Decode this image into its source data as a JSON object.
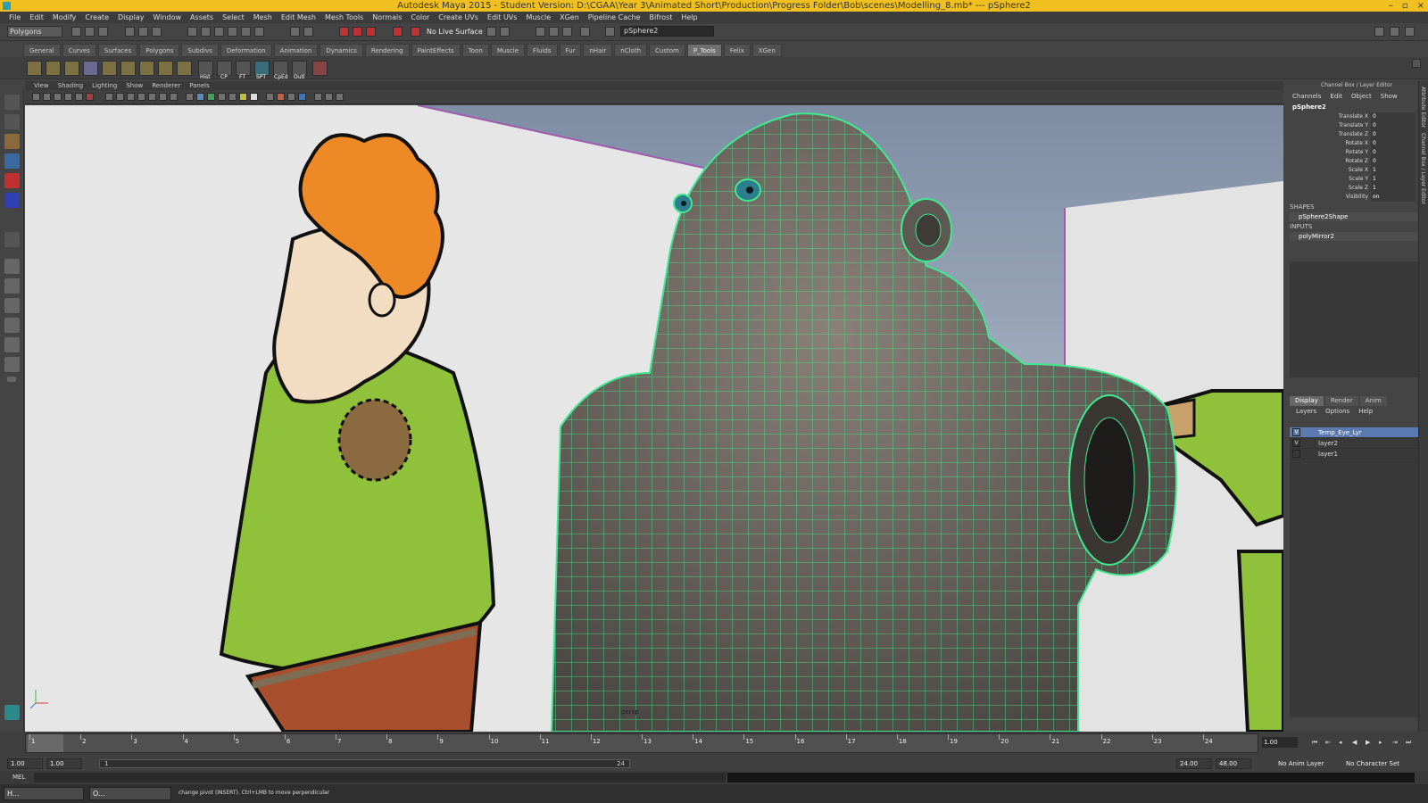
{
  "window": {
    "title": "Autodesk Maya 2015 - Student Version: D:\\CGAA\\Year 3\\Animated Short\\Production\\Progress Folder\\Bob\\scenes\\Modelling_8.mb*  ---  pSphere2",
    "minimize": "–",
    "maximize": "▫",
    "close": "×"
  },
  "menubar": [
    "File",
    "Edit",
    "Modify",
    "Create",
    "Display",
    "Window",
    "Assets",
    "Select",
    "Mesh",
    "Edit Mesh",
    "Mesh Tools",
    "Normals",
    "Color",
    "Create UVs",
    "Edit UVs",
    "Muscle",
    "XGen",
    "Pipeline Cache",
    "Bifrost",
    "Help"
  ],
  "statusline": {
    "mode": "Polygons",
    "live_surface": "No Live Surface",
    "object_field": "pSphere2"
  },
  "shelf": {
    "tabs": [
      "General",
      "Curves",
      "Surfaces",
      "Polygons",
      "Subdivs",
      "Deformation",
      "Animation",
      "Dynamics",
      "Rendering",
      "PaintEffects",
      "Toon",
      "Muscle",
      "Fluids",
      "Fur",
      "nHair",
      "nCloth",
      "Custom",
      "P_Tools",
      "Felix",
      "XGen"
    ],
    "active_tab": "P_Tools",
    "labels": [
      "Hist",
      "CP",
      "FT",
      "SPT",
      "CpEd",
      "Outl"
    ]
  },
  "viewport": {
    "menus": [
      "View",
      "Shading",
      "Lighting",
      "Show",
      "Renderer",
      "Panels"
    ],
    "camera_label": "persp"
  },
  "channel_box": {
    "header": "Channel Box / Layer Editor",
    "menus": [
      "Channels",
      "Edit",
      "Object",
      "Show"
    ],
    "object": "pSphere2",
    "attributes": [
      {
        "name": "Translate X",
        "value": "0"
      },
      {
        "name": "Translate Y",
        "value": "0"
      },
      {
        "name": "Translate Z",
        "value": "0"
      },
      {
        "name": "Rotate X",
        "value": "0"
      },
      {
        "name": "Rotate Y",
        "value": "0"
      },
      {
        "name": "Rotate Z",
        "value": "0"
      },
      {
        "name": "Scale X",
        "value": "1"
      },
      {
        "name": "Scale Y",
        "value": "1"
      },
      {
        "name": "Scale Z",
        "value": "1"
      },
      {
        "name": "Visibility",
        "value": "on"
      }
    ],
    "shapes_label": "SHAPES",
    "shape": "pSphere2Shape",
    "inputs_label": "INPUTS",
    "input": "polyMirror2"
  },
  "layer_editor": {
    "tabs": [
      "Display",
      "Render",
      "Anim"
    ],
    "active_tab": "Display",
    "menus": [
      "Layers",
      "Options",
      "Help"
    ],
    "layers": [
      {
        "name": "Temp_Eye_Lyr",
        "visible": "V",
        "selected": true
      },
      {
        "name": "layer2",
        "visible": "V",
        "selected": false
      },
      {
        "name": "layer1",
        "visible": "",
        "selected": false
      }
    ]
  },
  "right_strip": [
    "Attribute Editor",
    "Channel Box / Layer Editor"
  ],
  "timeline": {
    "ticks": [
      "1",
      "2",
      "3",
      "4",
      "5",
      "6",
      "7",
      "8",
      "9",
      "10",
      "11",
      "12",
      "13",
      "14",
      "15",
      "16",
      "17",
      "18",
      "19",
      "20",
      "21",
      "22",
      "23",
      "24"
    ],
    "current_frame": "1.00"
  },
  "range": {
    "start": "1.00",
    "start_inner": "1.00",
    "range_start_marker": "1",
    "range_end_marker": "24",
    "end_inner": "24.00",
    "end": "48.00",
    "anim_layer": "No Anim Layer",
    "character_set": "No Character Set"
  },
  "mel": {
    "label": "MEL"
  },
  "taskbar": {
    "items": [
      "H...",
      "O..."
    ],
    "help_line": "change pivot (INSERT).  Ctrl+LMB to move perpendicular"
  },
  "colors": {
    "title_bar": "#f0c020",
    "wireframe": "#40e890",
    "selected_layer": "#5b7ab1"
  }
}
